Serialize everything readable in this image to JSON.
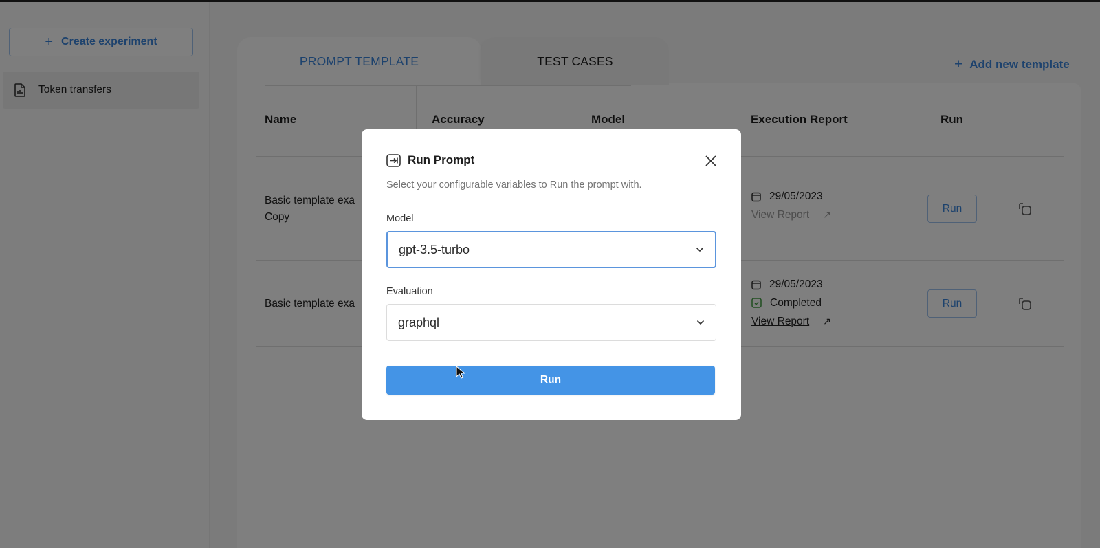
{
  "sidebar": {
    "create_button": {
      "icon": "plus-icon",
      "label": "Create experiment"
    },
    "items": [
      {
        "icon": "report-document-icon",
        "label": "Token transfers",
        "selected": true
      }
    ]
  },
  "main": {
    "tabs": [
      {
        "label": "PROMPT TEMPLATE",
        "active": true
      },
      {
        "label": "TEST CASES",
        "active": false
      }
    ],
    "add_template": {
      "icon": "plus-icon",
      "label": "Add new template"
    },
    "table": {
      "columns": [
        "Name",
        "Accuracy",
        "Model",
        "Execution Report",
        "Run"
      ],
      "rows": [
        {
          "name_line1": "Basic template exa",
          "name_line2": "Copy",
          "date": "29/05/2023",
          "status": "",
          "report_link": "View Report",
          "run_label": "Run"
        },
        {
          "name_line1": "Basic template exa",
          "name_line2": "",
          "date": "29/05/2023",
          "status": "Completed",
          "report_link": "View Report",
          "run_label": "Run"
        }
      ]
    }
  },
  "modal": {
    "icon": "run-arrow-icon",
    "title": "Run Prompt",
    "subtitle": "Select your configurable variables to Run the prompt with.",
    "fields": [
      {
        "label": "Model",
        "value": "gpt-3.5-turbo"
      },
      {
        "label": "Evaluation",
        "value": "graphql"
      }
    ],
    "run_button": "Run"
  },
  "colors": {
    "accent": "#3a84da",
    "primary_button": "#4494e6",
    "completed": "#3f9a3f"
  }
}
